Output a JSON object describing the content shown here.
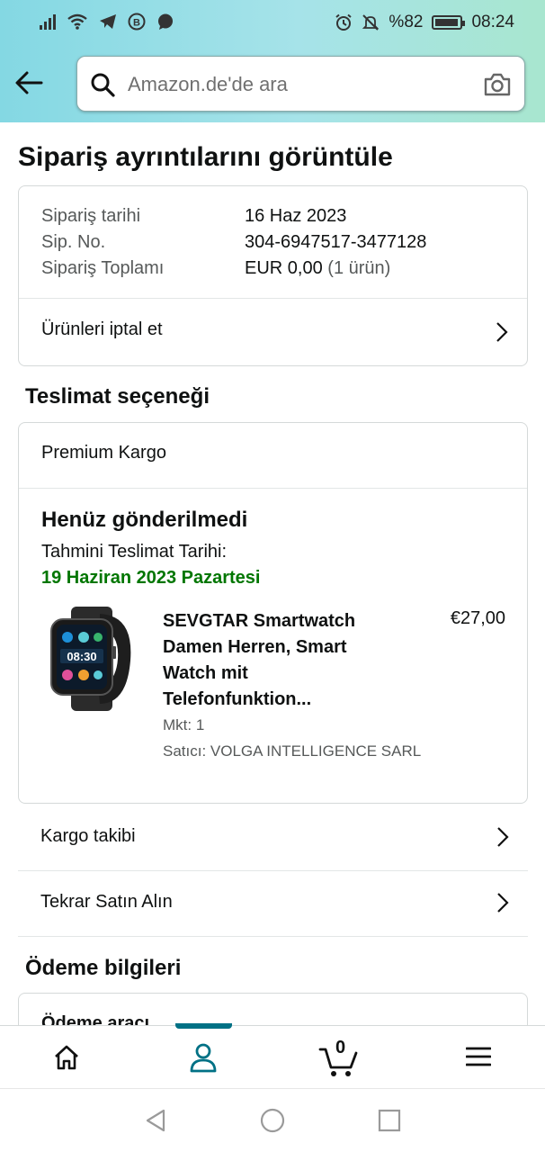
{
  "status_bar": {
    "battery": "%82",
    "time": "08:24",
    "icons": [
      "signal-icon",
      "wifi-icon",
      "telegram-icon",
      "b-icon",
      "chat-icon",
      "alarm-icon",
      "mute-icon",
      "battery-icon"
    ]
  },
  "header": {
    "search_placeholder": "Amazon.de'de ara"
  },
  "page": {
    "title": "Sipariş ayrıntılarını görüntüle"
  },
  "order": {
    "date_label": "Sipariş tarihi",
    "date_value": "16 Haz 2023",
    "number_label": "Sip. No.",
    "number_value": "304-6947517-3477128",
    "total_label": "Sipariş Toplamı",
    "total_value": "EUR 0,00",
    "total_count": "(1 ürün)",
    "cancel_label": "Ürünleri iptal et"
  },
  "delivery": {
    "section_title": "Teslimat seçeneği",
    "option": "Premium Kargo",
    "status": "Henüz gönderilmedi",
    "estimate_label": "Tahmini Teslimat Tarihi:",
    "estimate_date": "19 Haziran 2023 Pazartesi",
    "item": {
      "name": "SEVGTAR Smartwatch Damen Herren, Smart Watch mit Telefonfunktion...",
      "price": "€27,00",
      "qty": "Mkt: 1",
      "seller": "Satıcı: VOLGA INTELLIGENCE SARL"
    },
    "track_label": "Kargo takibi",
    "buy_again_label": "Tekrar Satın Alın"
  },
  "payment": {
    "section_title": "Ödeme bilgileri",
    "method_label": "Ödeme aracı"
  },
  "bottom_nav": {
    "cart_count": "0",
    "active_color": "#007185"
  },
  "colors": {
    "accent": "#007185",
    "success_green": "#007600"
  }
}
